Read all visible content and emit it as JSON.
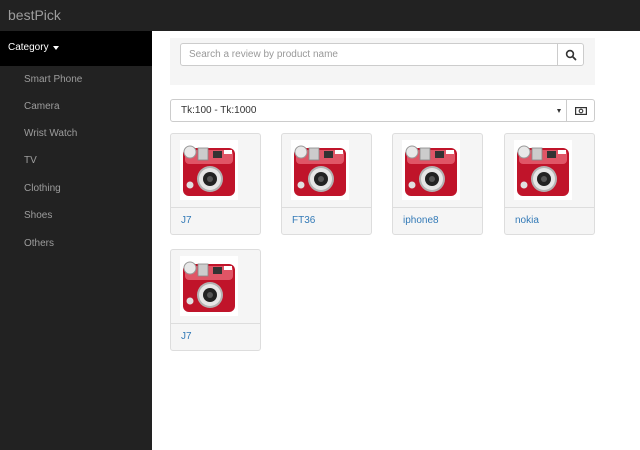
{
  "navbar": {
    "brand": "bestPick"
  },
  "sidebar": {
    "header": "Category",
    "items": [
      {
        "label": "Smart Phone"
      },
      {
        "label": "Camera"
      },
      {
        "label": "Wrist Watch"
      },
      {
        "label": "TV"
      },
      {
        "label": "Clothing"
      },
      {
        "label": "Shoes"
      },
      {
        "label": "Others"
      }
    ]
  },
  "search": {
    "placeholder": "Search a review by product name",
    "value": "",
    "button_icon": "search-icon"
  },
  "filter": {
    "selected": "Tk:100 - Tk:1000",
    "button_icon": "money-icon"
  },
  "products": [
    {
      "name": "J7",
      "image_icon": "camera-image"
    },
    {
      "name": "FT36",
      "image_icon": "camera-image"
    },
    {
      "name": "iphone8",
      "image_icon": "camera-image"
    },
    {
      "name": "nokia",
      "image_icon": "camera-image"
    },
    {
      "name": "J7",
      "image_icon": "camera-image"
    }
  ],
  "colors": {
    "navbar_bg": "#222222",
    "sidebar_active_bg": "#000000",
    "link": "#337ab7",
    "card_bg": "#f5f5f5",
    "camera_red": "#c0142a"
  }
}
